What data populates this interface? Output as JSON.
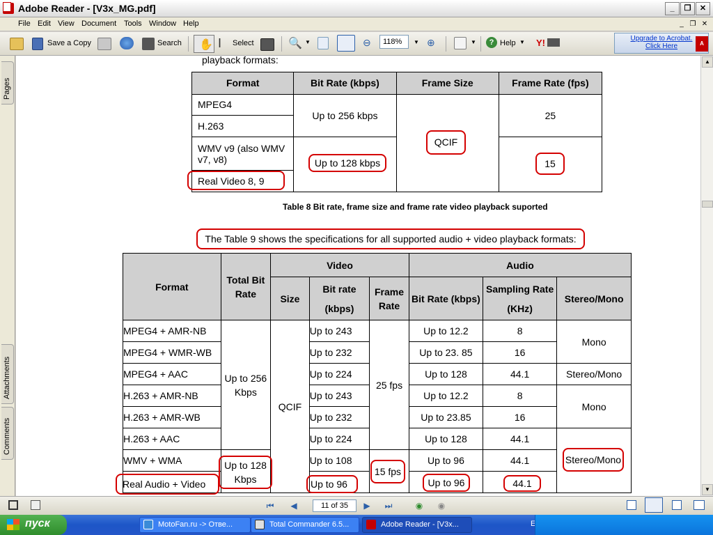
{
  "window": {
    "title": "Adobe Reader - [V3x_MG.pdf]",
    "icon": "adobe-reader-icon"
  },
  "menu": [
    "File",
    "Edit",
    "View",
    "Document",
    "Tools",
    "Window",
    "Help"
  ],
  "toolbar": {
    "save_copy": "Save a Copy",
    "search": "Search",
    "select": "Select",
    "zoom": "118%",
    "help": "Help",
    "upgrade_line1": "Upgrade to Acrobat.",
    "upgrade_line2": "Click Here"
  },
  "side_tabs": {
    "pages": "Pages",
    "attachments": "Attachments",
    "comments": "Comments"
  },
  "doc": {
    "top_fragment": "playback formats:",
    "table8": {
      "headers": [
        "Format",
        "Bit Rate (kbps)",
        "Frame Size",
        "Frame Rate (fps)"
      ],
      "formats": [
        "MPEG4",
        "H.263",
        "WMV v9 (also WMV v7, v8)",
        "Real Video 8, 9"
      ],
      "bitrate_a": "Up to 256 kbps",
      "bitrate_b": "Up to 128 kbps",
      "frame_size": "QCIF",
      "frame_rate_a": "25",
      "frame_rate_b": "15"
    },
    "table8_caption": "Table 8 Bit rate, frame size and frame rate video playback suported",
    "table9_intro": "The Table 9 shows the specifications for all supported audio + video playback formats:",
    "table9": {
      "h_format": "Format",
      "h_total": "Total Bit Rate",
      "h_video": "Video",
      "h_audio": "Audio",
      "h_size": "Size",
      "h_vbitrate": "Bit rate (kbps)",
      "h_framerate": "Frame Rate",
      "h_abitrate": "Bit Rate (kbps)",
      "h_sampling": "Sampling Rate (KHz)",
      "h_stereo": "Stereo/Mono",
      "total_a": "Up to 256 Kbps",
      "total_b": "Up to 128 Kbps",
      "size": "QCIF",
      "fps_a": "25 fps",
      "fps_b": "15 fps",
      "rows": [
        {
          "format": "MPEG4 + AMR-NB",
          "vbit": "Up to 243",
          "abit": "Up to 12.2",
          "samp": "8"
        },
        {
          "format": "MPEG4 + WMR-WB",
          "vbit": "Up to 232",
          "abit": "Up to 23. 85",
          "samp": "16"
        },
        {
          "format": "MPEG4 + AAC",
          "vbit": "Up to 224",
          "abit": "Up to 128",
          "samp": "44.1"
        },
        {
          "format": "H.263 + AMR-NB",
          "vbit": "Up to 243",
          "abit": "Up to 12.2",
          "samp": "8"
        },
        {
          "format": "H.263 + AMR-WB",
          "vbit": "Up to 232",
          "abit": "Up to 23.85",
          "samp": "16"
        },
        {
          "format": "H.263 + AAC",
          "vbit": "Up to 224",
          "abit": "Up to 128",
          "samp": "44.1"
        },
        {
          "format": "WMV + WMA",
          "vbit": "Up to 108",
          "abit": "Up to 96",
          "samp": "44.1"
        },
        {
          "format": "Real Audio + Video",
          "vbit": "Up to 96",
          "abit": "Up to 96",
          "samp": "44.1"
        }
      ],
      "mono": "Mono",
      "stereo_mono": "Stereo/Mono"
    }
  },
  "status": {
    "page": "11 of 35"
  },
  "taskbar": {
    "start": "пуск",
    "tasks": [
      "MotoFan.ru -> Отве...",
      "Total Commander 6.5...",
      "Adobe Reader - [V3x..."
    ],
    "lang": "EN"
  },
  "colors": {
    "annotation": "#d40000",
    "header_gray": "#d0d0d0",
    "taskbar_blue": "#2456c8"
  }
}
